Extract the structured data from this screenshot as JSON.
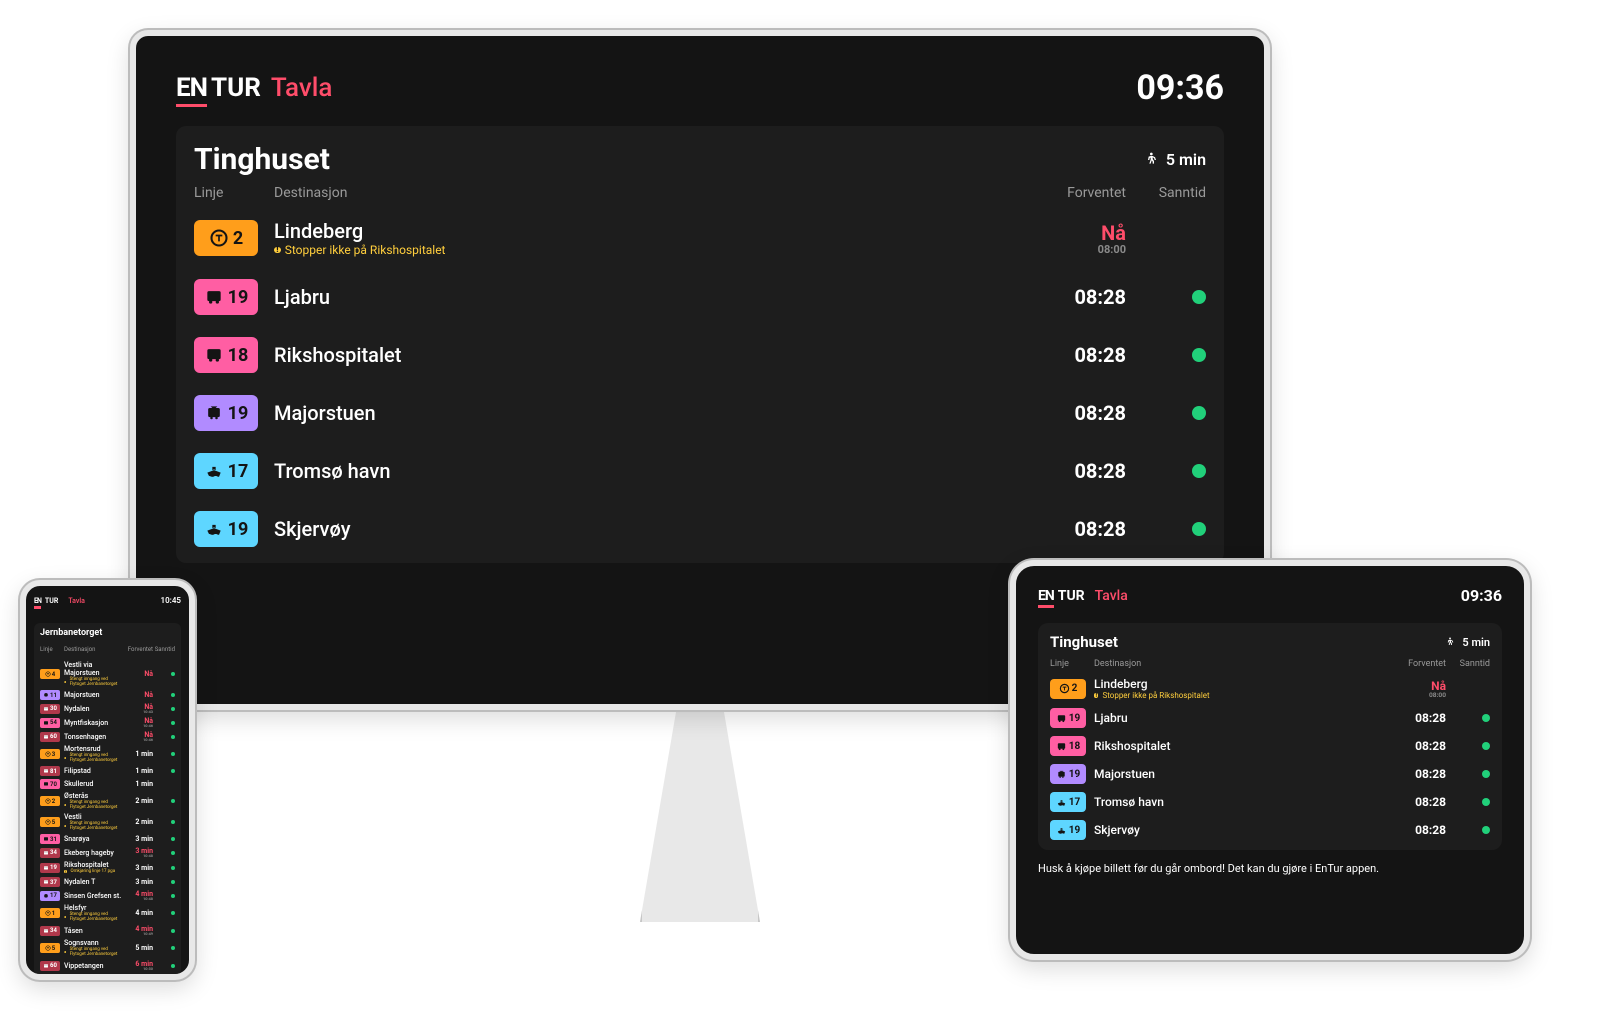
{
  "brand": {
    "en": "EN",
    "tur": "TUR",
    "tavla": "Tavla"
  },
  "monitor": {
    "clock": "09:36",
    "stop": "Tinghuset",
    "walk": "5 min",
    "cols": {
      "line": "Linje",
      "dest": "Destinasjon",
      "expected": "Forventet",
      "realtime": "Sanntid"
    },
    "rows": [
      {
        "mode": "metro",
        "color": "orange",
        "line": "2",
        "dest": "Lindeberg",
        "note": "Stopper ikke på Rikshospitalet",
        "expected": "Nå",
        "now": true,
        "sched": "08:00",
        "rt": false
      },
      {
        "mode": "bus",
        "color": "pink",
        "line": "19",
        "dest": "Ljabru",
        "expected": "08:28",
        "rt": true
      },
      {
        "mode": "bus",
        "color": "pink",
        "line": "18",
        "dest": "Rikshospitalet",
        "expected": "08:28",
        "rt": true
      },
      {
        "mode": "tram",
        "color": "purple",
        "line": "19",
        "dest": "Majorstuen",
        "expected": "08:28",
        "rt": true
      },
      {
        "mode": "boat",
        "color": "cyan",
        "line": "17",
        "dest": "Tromsø havn",
        "expected": "08:28",
        "rt": true
      },
      {
        "mode": "boat",
        "color": "cyan",
        "line": "19",
        "dest": "Skjervøy",
        "expected": "08:28",
        "rt": true
      }
    ]
  },
  "tablet": {
    "clock": "09:36",
    "stop": "Tinghuset",
    "walk": "5 min",
    "cols": {
      "line": "Linje",
      "dest": "Destinasjon",
      "expected": "Forventet",
      "realtime": "Sanntid"
    },
    "footer": "Husk å kjøpe billett før du går ombord! Det kan du gjøre i EnTur appen.",
    "rows": [
      {
        "mode": "metro",
        "color": "orange",
        "line": "2",
        "dest": "Lindeberg",
        "note": "Stopper ikke på Rikshospitalet",
        "expected": "Nå",
        "now": true,
        "sched": "08:00",
        "rt": false
      },
      {
        "mode": "bus",
        "color": "pink",
        "line": "19",
        "dest": "Ljabru",
        "expected": "08:28",
        "rt": true
      },
      {
        "mode": "bus",
        "color": "pink",
        "line": "18",
        "dest": "Rikshospitalet",
        "expected": "08:28",
        "rt": true
      },
      {
        "mode": "tram",
        "color": "purple",
        "line": "19",
        "dest": "Majorstuen",
        "expected": "08:28",
        "rt": true
      },
      {
        "mode": "boat",
        "color": "cyan",
        "line": "17",
        "dest": "Tromsø havn",
        "expected": "08:28",
        "rt": true
      },
      {
        "mode": "boat",
        "color": "cyan",
        "line": "19",
        "dest": "Skjervøy",
        "expected": "08:28",
        "rt": true
      }
    ]
  },
  "phone": {
    "clock": "10:45",
    "stop": "Jernbanetorget",
    "cols": {
      "line": "Linje",
      "dest": "Destinasjon",
      "expected": "Forventet",
      "realtime": "Sanntid"
    },
    "rows": [
      {
        "mode": "metro",
        "color": "orange",
        "line": "4",
        "dest": "Vestli via Majorstuen",
        "note": "Stengt inngang ved Flytoget Jernbanetorget",
        "expected": "Nå",
        "now": true,
        "rt": true
      },
      {
        "mode": "tram",
        "color": "purple",
        "line": "11",
        "dest": "Majorstuen",
        "expected": "Nå",
        "now": true,
        "rt": true
      },
      {
        "mode": "bus",
        "color": "darkred",
        "line": "30",
        "dest": "Nydalen",
        "expected": "Nå",
        "now": true,
        "sched": "10:43",
        "rt": true
      },
      {
        "mode": "bus",
        "color": "pink",
        "line": "54",
        "dest": "Myntfiskasjon",
        "expected": "Nå",
        "now": true,
        "sched": "10:46",
        "rt": true
      },
      {
        "mode": "bus",
        "color": "darkred",
        "line": "60",
        "dest": "Tonsenhagen",
        "expected": "Nå",
        "now": true,
        "sched": "10:46",
        "rt": true
      },
      {
        "mode": "metro",
        "color": "orange",
        "line": "3",
        "dest": "Mortensrud",
        "note": "Stengt inngang ved Flytoget Jernbanetorget",
        "expected": "1 min",
        "rt": true
      },
      {
        "mode": "bus",
        "color": "darkred",
        "line": "81",
        "dest": "Filipstad",
        "expected": "1 min",
        "rt": true
      },
      {
        "mode": "bus",
        "color": "pink",
        "line": "70",
        "dest": "Skullerud",
        "expected": "1 min",
        "rt": false
      },
      {
        "mode": "metro",
        "color": "orange",
        "line": "2",
        "dest": "Østerås",
        "note": "Stengt inngang ved Flytoget Jernbanetorget",
        "expected": "2 min",
        "rt": true
      },
      {
        "mode": "metro",
        "color": "orange",
        "line": "5",
        "dest": "Vestli",
        "note": "Stengt inngang ved Flytoget Jernbanetorget",
        "expected": "2 min",
        "rt": true
      },
      {
        "mode": "bus",
        "color": "pink",
        "line": "31",
        "dest": "Snarøya",
        "expected": "3 min",
        "rt": true
      },
      {
        "mode": "bus",
        "color": "darkred",
        "line": "34",
        "dest": "Ekeberg hageby",
        "expected": "3 min",
        "now": true,
        "sched": "10:48",
        "rt": true
      },
      {
        "mode": "bus",
        "color": "darkred",
        "line": "19",
        "dest": "Rikshospitalet",
        "note": "Omkjøring linje 17 pga",
        "expected": "3 min",
        "rt": true
      },
      {
        "mode": "bus",
        "color": "darkred",
        "line": "37",
        "dest": "Nydalen T",
        "expected": "3 min",
        "rt": true
      },
      {
        "mode": "tram",
        "color": "purple",
        "line": "17",
        "dest": "Sinsen Grefsen st.",
        "expected": "4 min",
        "now": true,
        "sched": "10:48",
        "rt": true
      },
      {
        "mode": "metro",
        "color": "orange",
        "line": "1",
        "dest": "Helsfyr",
        "note": "Stengt inngang ved Flytoget Jernbanetorget",
        "expected": "4 min",
        "rt": true
      },
      {
        "mode": "bus",
        "color": "darkred",
        "line": "34",
        "dest": "Tåsen",
        "expected": "4 min",
        "now": true,
        "sched": "10:49",
        "rt": true
      },
      {
        "mode": "metro",
        "color": "orange",
        "line": "5",
        "dest": "Sognsvann",
        "note": "Stengt inngang ved Flytoget Jernbanetorget",
        "expected": "5 min",
        "rt": true
      },
      {
        "mode": "bus",
        "color": "darkred",
        "line": "60",
        "dest": "Vippetangen",
        "expected": "6 min",
        "now": true,
        "sched": "10:50",
        "rt": true
      }
    ]
  }
}
